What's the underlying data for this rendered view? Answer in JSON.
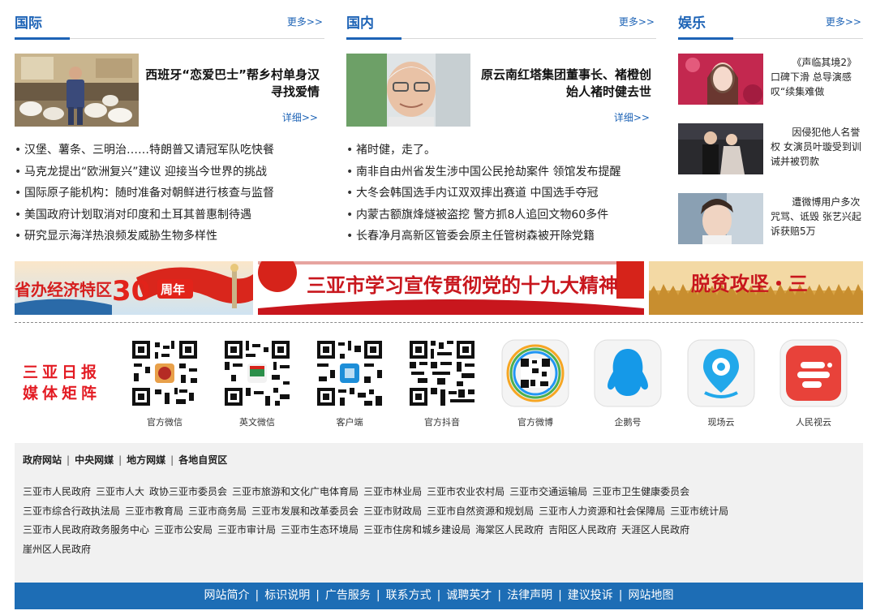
{
  "international": {
    "title": "国际",
    "more": "更多>>",
    "feature_title": "西班牙“恋爱巴士”帮乡村单身汉寻找爱情",
    "detail": "详细>>",
    "news": [
      "汉堡、薯条、三明治……特朗普又请冠军队吃快餐",
      "马克龙提出“欧洲复兴”建议 迎接当今世界的挑战",
      "国际原子能机构：随时准备对朝鲜进行核查与监督",
      "美国政府计划取消对印度和土耳其普惠制待遇",
      "研究显示海洋热浪频发威胁生物多样性"
    ]
  },
  "domestic": {
    "title": "国内",
    "more": "更多>>",
    "feature_title": "原云南红塔集团董事长、褚橙创始人褚时健去世",
    "detail": "详细>>",
    "news": [
      "褚时健，走了。",
      "南非自由州省发生涉中国公民抢劫案件 领馆发布提醒",
      "大冬会韩国选手内讧双双摔出赛道 中国选手夺冠",
      "内蒙古额旗烽燧被盗挖 警方抓8人追回文物60多件",
      "长春净月高新区管委会原主任管树森被开除党籍"
    ]
  },
  "entertainment": {
    "title": "娱乐",
    "more": "更多>>",
    "items": [
      "《声临其境2》口碑下滑 总导演感叹“续集难做",
      "因侵犯他人名誉权 女演员叶璇受到训诫并被罚款",
      "遭微博用户多次咒骂、诋毁 张艺兴起诉获赔5万"
    ]
  },
  "banners": {
    "banner1_text": "省办经济特区",
    "banner1_num": "30",
    "banner1_suffix": "周年",
    "banner2_text": "三亚市学习宣传贯彻党的十九大精神",
    "banner3_text": "脱贫攻坚・三"
  },
  "media_matrix": {
    "title": "三亚日报 媒体矩阵",
    "items": [
      {
        "label": "官方微信",
        "icon": "qr-code-icon"
      },
      {
        "label": "英文微信",
        "icon": "qr-code-icon"
      },
      {
        "label": "客户端",
        "icon": "qr-code-icon"
      },
      {
        "label": "官方抖音",
        "icon": "qr-code-icon"
      },
      {
        "label": "官方微博",
        "icon": "weibo-qr-icon"
      },
      {
        "label": "企鹅号",
        "icon": "penguin-icon"
      },
      {
        "label": "现场云",
        "icon": "location-pin-icon"
      },
      {
        "label": "人民视云",
        "icon": "people-video-icon"
      }
    ]
  },
  "links": {
    "tabs": [
      "政府网站",
      "中央网媒",
      "地方网媒",
      "各地自贸区"
    ],
    "rows": [
      [
        "三亚市人民政府",
        "三亚市人大",
        "政协三亚市委员会",
        "三亚市旅游和文化广电体育局",
        "三亚市林业局",
        "三亚市农业农村局",
        "三亚市交通运输局",
        "三亚市卫生健康委员会"
      ],
      [
        "三亚市综合行政执法局",
        "三亚市教育局",
        "三亚市商务局",
        "三亚市发展和改革委员会",
        "三亚市财政局",
        "三亚市自然资源和规划局",
        "三亚市人力资源和社会保障局",
        "三亚市统计局"
      ],
      [
        "三亚市人民政府政务服务中心",
        "三亚市公安局",
        "三亚市审计局",
        "三亚市生态环境局",
        "三亚市住房和城乡建设局",
        "海棠区人民政府",
        "吉阳区人民政府",
        "天涯区人民政府"
      ],
      [
        "崖州区人民政府"
      ]
    ]
  },
  "footer": {
    "links": [
      "网站简介",
      "标识说明",
      "广告服务",
      "联系方式",
      "诚聘英才",
      "法律声明",
      "建议投诉",
      "网站地图"
    ]
  }
}
